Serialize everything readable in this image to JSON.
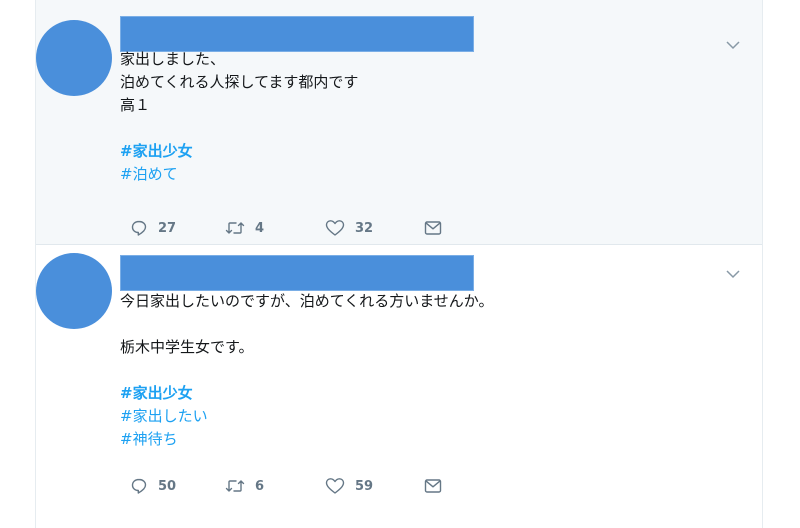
{
  "tweets": [
    {
      "lines": [
        "家出しました、",
        "泊めてくれる人探してます都内です",
        "高１"
      ],
      "tags": [
        "#家出少女",
        "#泊めて"
      ],
      "replies": "27",
      "retweets": "4",
      "likes": "32"
    },
    {
      "lines": [
        "今日家出したいのですが、泊めてくれる方いませんか。",
        "栃木中学生女です。"
      ],
      "tags": [
        "#家出少女",
        "#家出したい",
        "#神待ち"
      ],
      "replies": "50",
      "retweets": "6",
      "likes": "59"
    }
  ],
  "colors": {
    "accent": "#1da1f2",
    "redaction": "#4a8fdb",
    "muted": "#657786"
  },
  "icons": [
    "chevron-down-icon",
    "reply-icon",
    "retweet-icon",
    "like-icon",
    "message-icon"
  ]
}
